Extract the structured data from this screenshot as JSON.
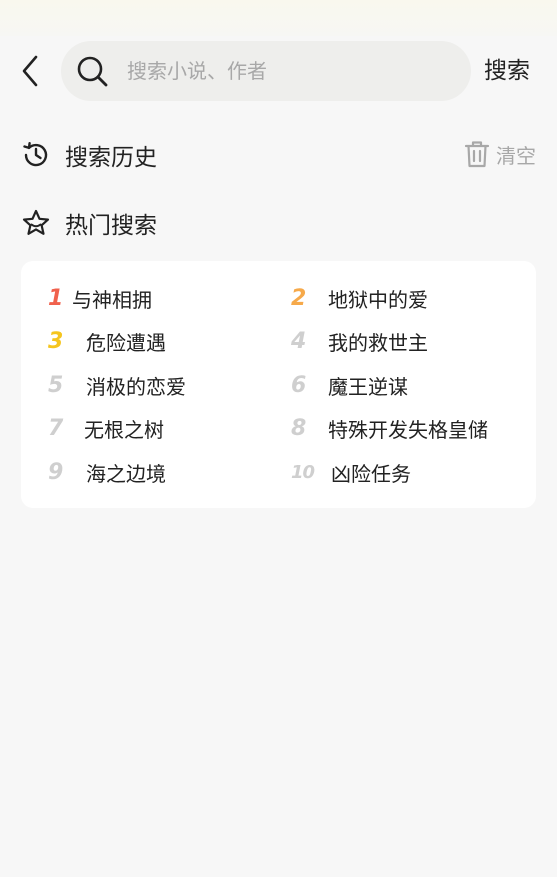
{
  "search": {
    "placeholder": "搜索小说、作者",
    "value": "",
    "submit_label": "搜索"
  },
  "history": {
    "title": "搜索历史",
    "clear_label": "清空"
  },
  "hot": {
    "title": "热门搜索",
    "items": [
      {
        "rank": "1",
        "name": "与神相拥"
      },
      {
        "rank": "2",
        "name": "地狱中的爱"
      },
      {
        "rank": "3",
        "name": "危险遭遇"
      },
      {
        "rank": "4",
        "name": "我的救世主"
      },
      {
        "rank": "5",
        "name": "消极的恋爱"
      },
      {
        "rank": "6",
        "name": "魔王逆谋"
      },
      {
        "rank": "7",
        "name": "无根之树"
      },
      {
        "rank": "8",
        "name": "特殊开发失格皇储"
      },
      {
        "rank": "9",
        "name": "海之边境"
      },
      {
        "rank": "10",
        "name": "凶险任务"
      }
    ]
  },
  "colors": {
    "rank_1": "#f0614d",
    "rank_2": "#f6a94a",
    "rank_3": "#f5c51f",
    "rank_other": "#cfcfcf",
    "background": "#f7f7f7",
    "search_box": "#eeeeec"
  },
  "icons": {
    "back": "chevron-left-icon",
    "search": "search-icon",
    "history": "history-clock-icon",
    "clear": "trash-icon",
    "hot": "star-icon"
  }
}
